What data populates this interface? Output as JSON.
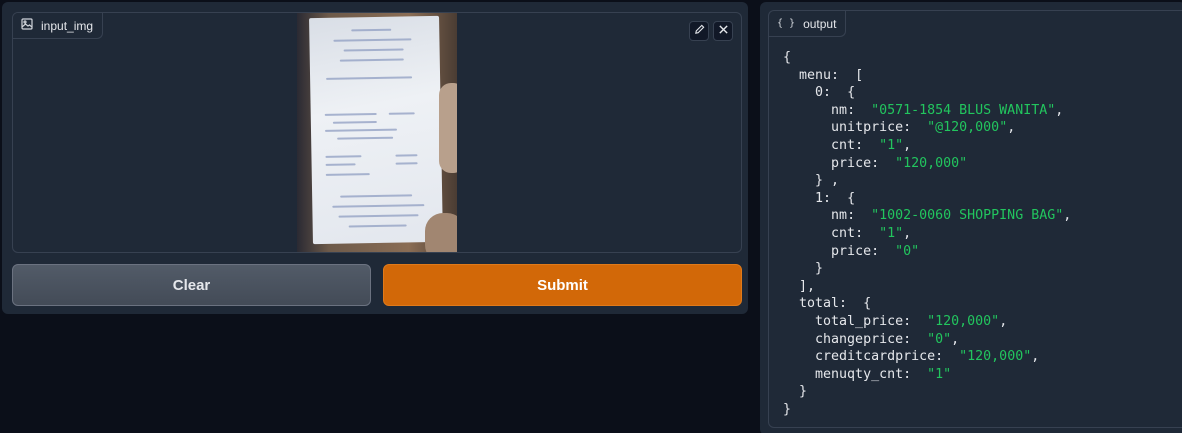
{
  "input_panel": {
    "label": "input_img",
    "edit_icon": "pencil-icon",
    "close_icon": "close-icon"
  },
  "buttons": {
    "clear": "Clear",
    "submit": "Submit"
  },
  "output_panel": {
    "label": "output",
    "icon": "json-braces-icon",
    "lines": [
      {
        "indent": 0,
        "text": "{"
      },
      {
        "indent": 1,
        "key": "menu",
        "text": "["
      },
      {
        "indent": 2,
        "key": "0",
        "text": "{"
      },
      {
        "indent": 3,
        "key": "nm",
        "value": "\"0571-1854 BLUS WANITA\"",
        "comma": true
      },
      {
        "indent": 3,
        "key": "unitprice",
        "value": "\"@120,000\"",
        "comma": true
      },
      {
        "indent": 3,
        "key": "cnt",
        "value": "\"1\"",
        "comma": true
      },
      {
        "indent": 3,
        "key": "price",
        "value": "\"120,000\""
      },
      {
        "indent": 2,
        "text": "} ,"
      },
      {
        "indent": 2,
        "key": "1",
        "text": "{"
      },
      {
        "indent": 3,
        "key": "nm",
        "value": "\"1002-0060 SHOPPING BAG\"",
        "comma": true
      },
      {
        "indent": 3,
        "key": "cnt",
        "value": "\"1\"",
        "comma": true
      },
      {
        "indent": 3,
        "key": "price",
        "value": "\"0\""
      },
      {
        "indent": 2,
        "text": "}"
      },
      {
        "indent": 1,
        "text": "],"
      },
      {
        "indent": 1,
        "key": "total",
        "text": "{"
      },
      {
        "indent": 2,
        "key": "total_price",
        "value": "\"120,000\"",
        "comma": true
      },
      {
        "indent": 2,
        "key": "changeprice",
        "value": "\"0\"",
        "comma": true
      },
      {
        "indent": 2,
        "key": "creditcardprice",
        "value": "\"120,000\"",
        "comma": true
      },
      {
        "indent": 2,
        "key": "menuqty_cnt",
        "value": "\"1\""
      },
      {
        "indent": 1,
        "text": "}"
      },
      {
        "indent": 0,
        "text": "}"
      }
    ]
  },
  "colors": {
    "background": "#0b0f19",
    "panel": "#1f2937",
    "accent": "#d26808",
    "string": "#22c55e"
  }
}
